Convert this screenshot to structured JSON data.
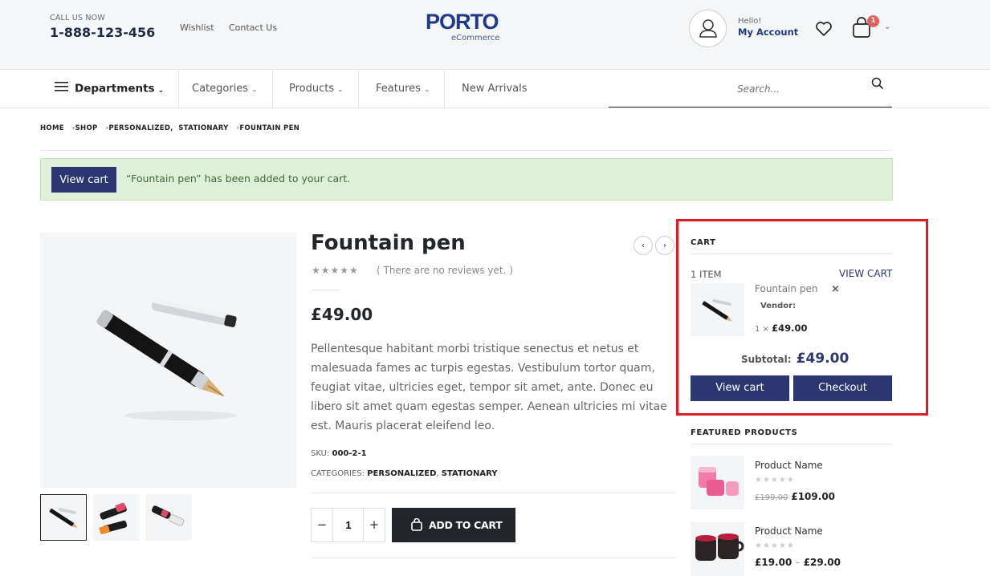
{
  "header": {
    "call_label": "CALL US NOW",
    "phone": "1-888-123-456",
    "links": [
      "Wishlist",
      "Contact Us"
    ],
    "logo": {
      "main": "PORTO",
      "sub": "eCommerce"
    },
    "account": {
      "hello": "Hello!",
      "label": "My Account"
    },
    "cart_count": "1"
  },
  "nav": {
    "departments": "Departments",
    "items": [
      "Categories",
      "Products",
      "Features",
      "New Arrivals"
    ],
    "search_placeholder": "Search..."
  },
  "breadcrumb": [
    "HOME",
    "SHOP",
    "PERSONALIZED,",
    "STATIONARY",
    "FOUNTAIN PEN"
  ],
  "notice": {
    "button": "View cart",
    "text": "“Fountain pen” has been added to your cart."
  },
  "product": {
    "title": "Fountain pen",
    "reviews": "( There are no reviews yet. )",
    "rating_stars": 0,
    "price": "£49.00",
    "description": "Pellentesque habitant morbi tristique senectus et netus et malesuada fames ac turpis egestas. Vestibulum tortor quam, feugiat vitae, ultricies eget, tempor sit amet, ante. Donec eu libero sit amet quam egestas semper. Aenean ultricies mi vitae est. Mauris placerat eleifend leo.",
    "sku_label": "SKU:",
    "sku": "000-2-1",
    "categories_label": "CATEGORIES:",
    "categories": [
      "PERSONALIZED",
      "STATIONARY"
    ],
    "quantity": "1",
    "add_to_cart": "ADD TO CART",
    "minus": "−",
    "plus": "+"
  },
  "cart_widget": {
    "title": "CART",
    "count": "1 ITEM",
    "view_cart_link": "VIEW CART",
    "item": {
      "name": "Fountain pen",
      "vendor": "Vendor:",
      "qty": "1 ×",
      "price": "£49.00",
      "remove": "×"
    },
    "subtotal_label": "Subtotal:",
    "subtotal": "£49.00",
    "view_cart_button": "View cart",
    "checkout_button": "Checkout"
  },
  "featured": {
    "title": "FEATURED PRODUCTS",
    "items": [
      {
        "name": "Product Name",
        "old_price": "£199.00",
        "price": "£109.00"
      },
      {
        "name": "Product Name",
        "price_from": "£19.00",
        "sep": "–",
        "price_to": "£29.00"
      }
    ]
  },
  "colors": {
    "accent": "#2a3770",
    "highlight": "#e01b24",
    "notice_bg": "#dff0d8"
  }
}
